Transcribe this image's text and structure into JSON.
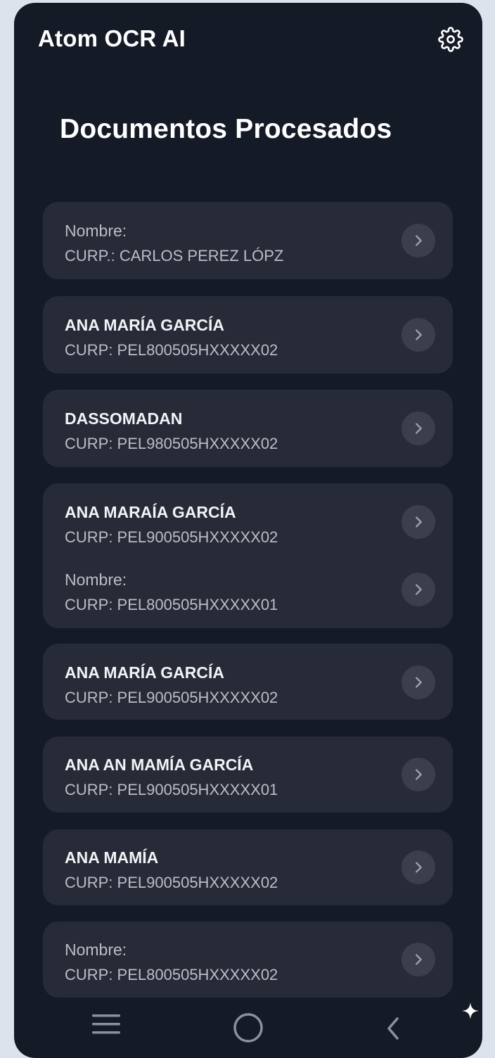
{
  "app": {
    "title": "Atom OCR AI",
    "settings_icon": "gear-icon"
  },
  "page": {
    "title": "Documentos Procesados"
  },
  "documents": [
    {
      "name": "Nombre:",
      "curp": "CURP.: CARLOS PEREZ LÓPZ"
    },
    {
      "name": "ANA MARÍA GARCÍA",
      "curp": "CURP: PEL800505HXXXXX02"
    },
    {
      "name": "DASSOMADAN",
      "curp": "CURP: PEL980505HXXXXX02"
    },
    {
      "name": "ANA MARAÍA GARCÍA",
      "curp": "CURP: PEL900505HXXXXX02"
    },
    {
      "name": "Nombre:",
      "curp": "CURP: PEL800505HXXXXX01"
    },
    {
      "name": "ANA MARÍA GARCÍA",
      "curp": "CURP: PEL900505HXXXXX02"
    },
    {
      "name": "ANA AN MAMÍA GARCÍA",
      "curp": "CURP: PEL900505HXXXXX01"
    },
    {
      "name": "ANA MAMÍA",
      "curp": "CURP: PEL900505HXXXXX02"
    },
    {
      "name": "Nombre:",
      "curp": "CURP: PEL800505HXXXXX02"
    }
  ],
  "icons": {
    "row_action": "chevron-right-icon",
    "nav_menu": "menu-icon",
    "nav_home": "home-circle-icon",
    "nav_back": "back-chevron-icon",
    "watermark": "sparkle-icon"
  },
  "colors": {
    "page_bg": "#dde3ec",
    "app_bg": "#151a27",
    "card_bg": "#262b37",
    "chevron_bg": "#3a3f4b",
    "text_primary": "#ffffff",
    "text_secondary": "#b9bec8"
  }
}
